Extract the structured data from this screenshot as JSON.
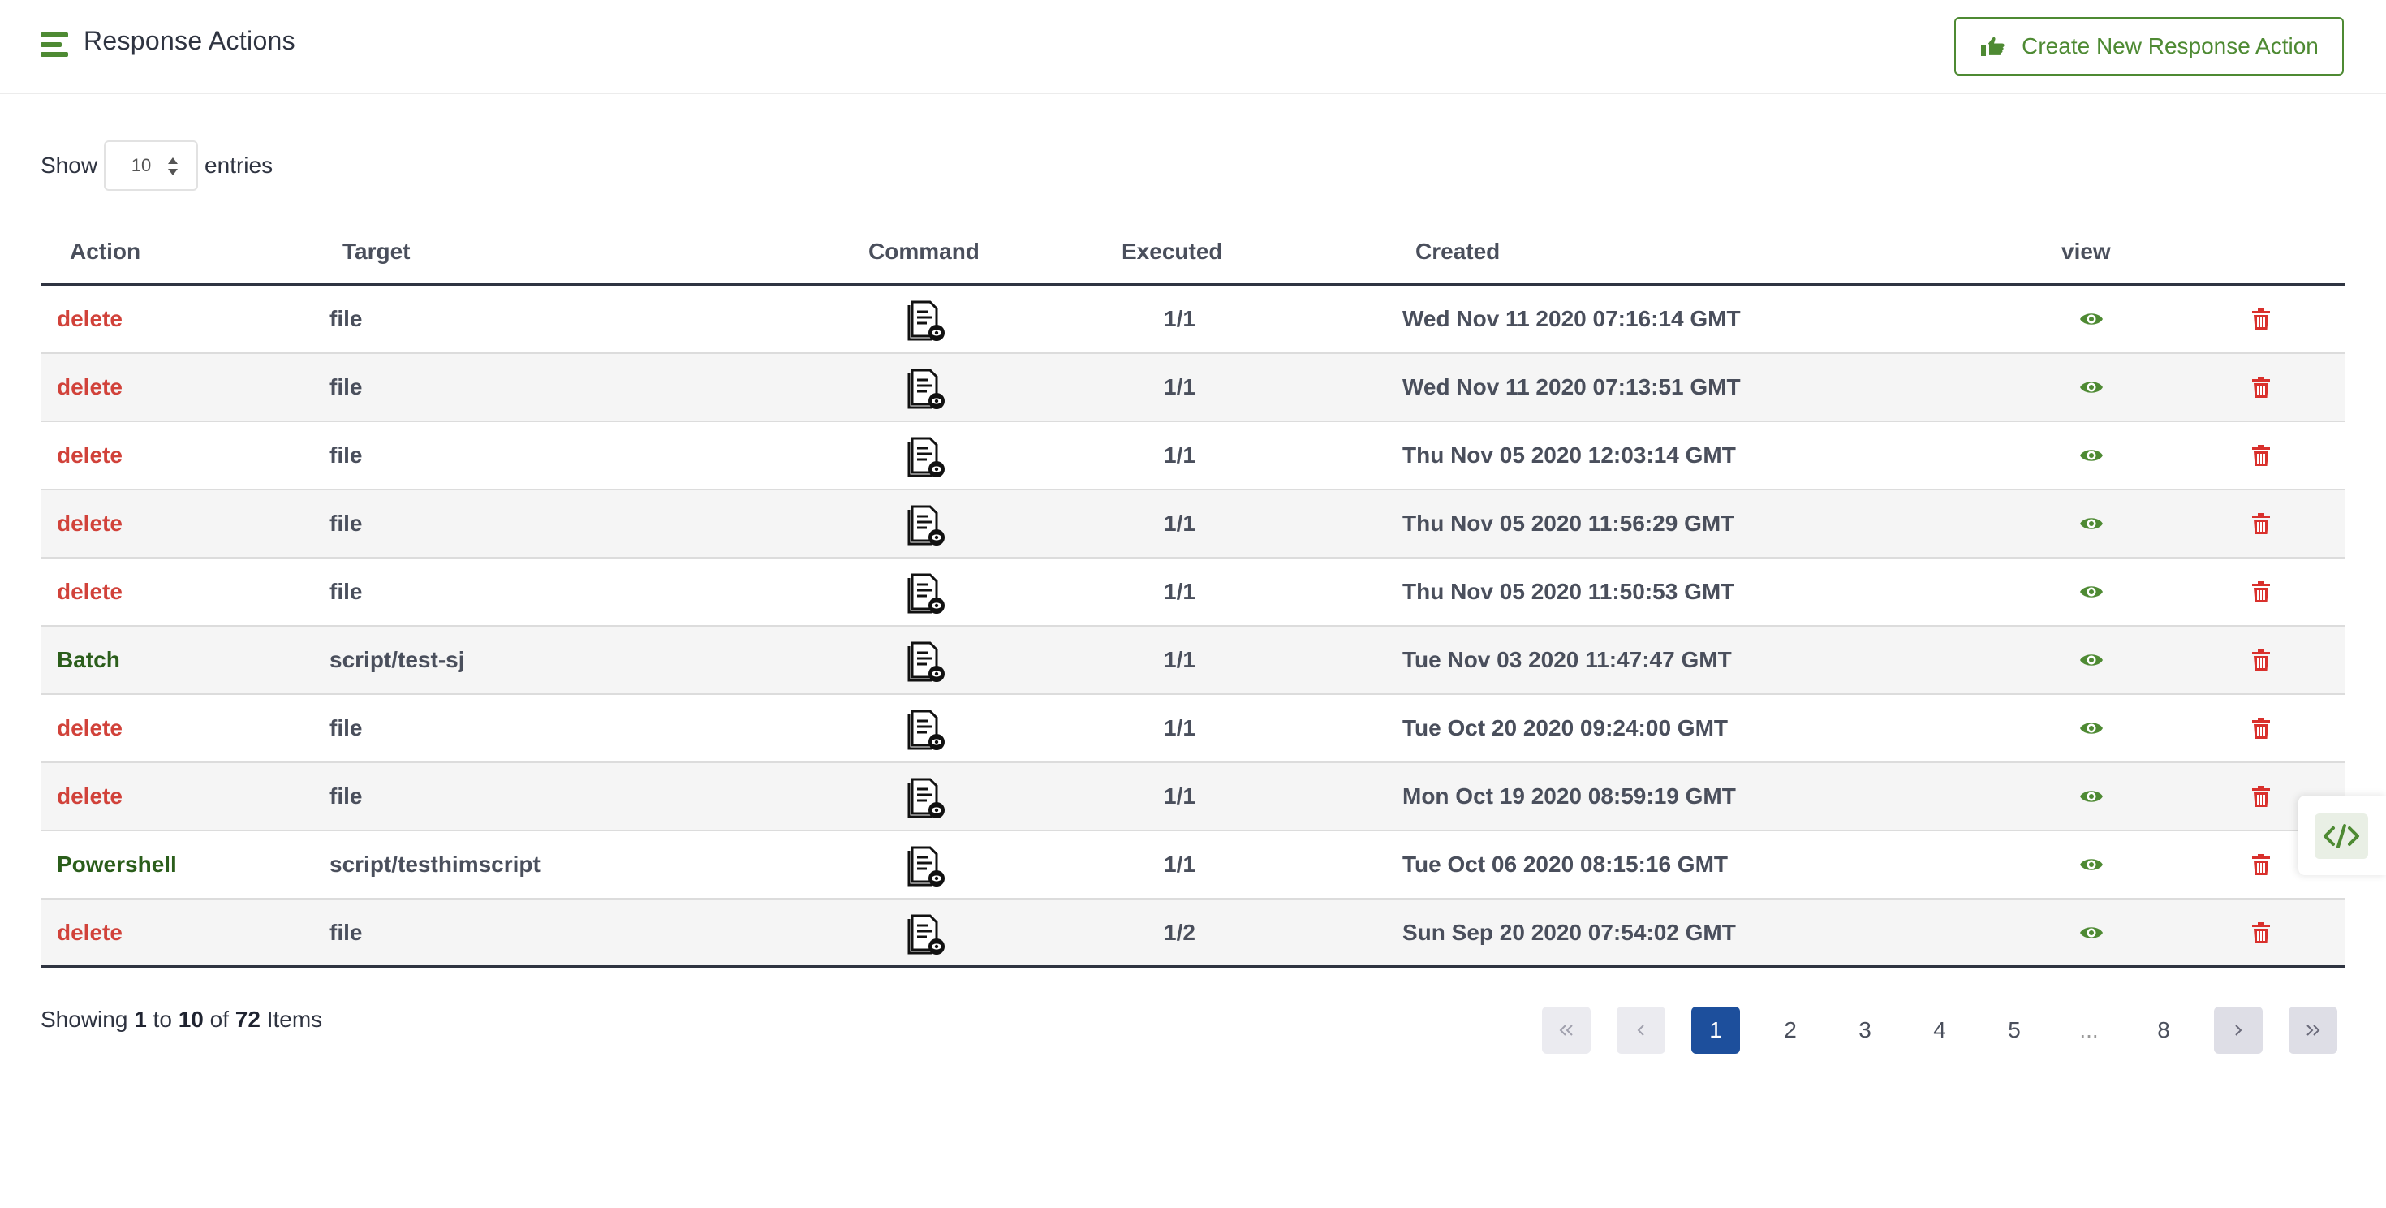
{
  "header": {
    "title": "Response Actions",
    "create_button_label": "Create New Response Action",
    "menu_icon": "hamburger-icon",
    "create_icon": "hand-pointer-icon"
  },
  "entries": {
    "show_label": "Show",
    "value": "10",
    "suffix_label": "entries"
  },
  "table": {
    "columns": [
      "Action",
      "Target",
      "Command",
      "Executed",
      "Created",
      "view"
    ],
    "rows": [
      {
        "action": "delete",
        "action_kind": "delete",
        "target": "file",
        "executed": "1/1",
        "created": "Wed Nov 11 2020 07:16:14 GMT"
      },
      {
        "action": "delete",
        "action_kind": "delete",
        "target": "file",
        "executed": "1/1",
        "created": "Wed Nov 11 2020 07:13:51 GMT"
      },
      {
        "action": "delete",
        "action_kind": "delete",
        "target": "file",
        "executed": "1/1",
        "created": "Thu Nov 05 2020 12:03:14 GMT"
      },
      {
        "action": "delete",
        "action_kind": "delete",
        "target": "file",
        "executed": "1/1",
        "created": "Thu Nov 05 2020 11:56:29 GMT"
      },
      {
        "action": "delete",
        "action_kind": "delete",
        "target": "file",
        "executed": "1/1",
        "created": "Thu Nov 05 2020 11:50:53 GMT"
      },
      {
        "action": "Batch",
        "action_kind": "script",
        "target": "script/test-sj",
        "executed": "1/1",
        "created": "Tue Nov 03 2020 11:47:47 GMT"
      },
      {
        "action": "delete",
        "action_kind": "delete",
        "target": "file",
        "executed": "1/1",
        "created": "Tue Oct 20 2020 09:24:00 GMT"
      },
      {
        "action": "delete",
        "action_kind": "delete",
        "target": "file",
        "executed": "1/1",
        "created": "Mon Oct 19 2020 08:59:19 GMT"
      },
      {
        "action": "Powershell",
        "action_kind": "script",
        "target": "script/testhimscript",
        "executed": "1/1",
        "created": "Tue Oct 06 2020 08:15:16 GMT"
      },
      {
        "action": "delete",
        "action_kind": "delete",
        "target": "file",
        "executed": "1/2",
        "created": "Sun Sep 20 2020 07:54:02 GMT"
      }
    ],
    "row_icons": {
      "command": "command-document-eye-icon",
      "view": "eye-icon",
      "delete": "trash-icon"
    }
  },
  "footer": {
    "showing_prefix": "Showing",
    "from": "1",
    "to_word": "to",
    "to": "10",
    "of_word": "of",
    "total": "72",
    "items_word": "Items"
  },
  "pagination": {
    "pages": [
      "1",
      "2",
      "3",
      "4",
      "5",
      "...",
      "8"
    ],
    "current": "1",
    "nav_icons": [
      "first-page-icon",
      "prev-page-icon",
      "next-page-icon",
      "last-page-icon"
    ]
  },
  "colors": {
    "accent_green": "#4e8a33",
    "action_delete": "#d1423a",
    "action_script": "#2b5e1b",
    "active_page": "#1d4f9c",
    "trash_red": "#d9302c"
  },
  "side_widget": {
    "icon": "code-icon"
  }
}
